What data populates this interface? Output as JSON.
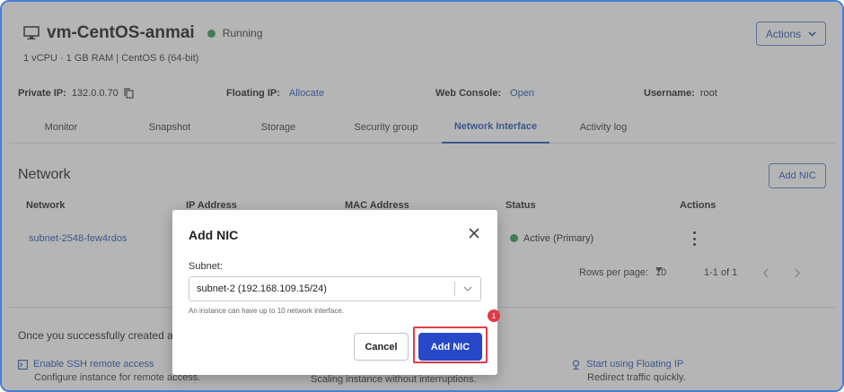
{
  "vm": {
    "name": "vm-CentOS-anmai",
    "status": "Running",
    "spec": "1 vCPU · 1 GB RAM | CentOS 6 (64-bit)",
    "actions_label": "Actions"
  },
  "info": {
    "private_ip_label": "Private IP:",
    "private_ip_value": "132.0.0.70",
    "floating_ip_label": "Floating IP:",
    "floating_ip_link": "Allocate",
    "web_console_label": "Web Console:",
    "web_console_link": "Open",
    "username_label": "Username:",
    "username_value": "root"
  },
  "tabs": [
    {
      "label": "Monitor"
    },
    {
      "label": "Snapshot"
    },
    {
      "label": "Storage"
    },
    {
      "label": "Security group"
    },
    {
      "label": "Network Interface"
    },
    {
      "label": "Activity log"
    }
  ],
  "network": {
    "title": "Network",
    "add_button": "Add NIC",
    "columns": [
      "Network",
      "IP Address",
      "MAC Address",
      "Status",
      "Actions"
    ],
    "rows": [
      {
        "network": "subnet-2548-few4rdos",
        "ip": "",
        "mac": "",
        "status": "Active (Primary)"
      }
    ],
    "rows_per_page_label": "Rows per page:",
    "rows_per_page_value": "10",
    "range": "1-1 of 1"
  },
  "guide": {
    "text": "Once you successfully created a",
    "items": [
      {
        "link": "Enable SSH remote access",
        "desc": "Configure instance for remote access."
      },
      {
        "link": "",
        "desc": "Scaling instance without interruptions."
      },
      {
        "link": "Start using Floating IP",
        "desc": "Redirect traffic quickly."
      }
    ]
  },
  "modal": {
    "title": "Add NIC",
    "subnet_label": "Subnet:",
    "subnet_value": "subnet-2 (192.168.109.15/24)",
    "helper": "An instance can have up to 10 network interface.",
    "cancel": "Cancel",
    "confirm": "Add NIC",
    "step_badge": "1"
  },
  "colors": {
    "accent": "#2455b3",
    "primary_button": "#2748c9",
    "status_green": "#2e9a4f",
    "highlight_red": "#e03a4a"
  }
}
